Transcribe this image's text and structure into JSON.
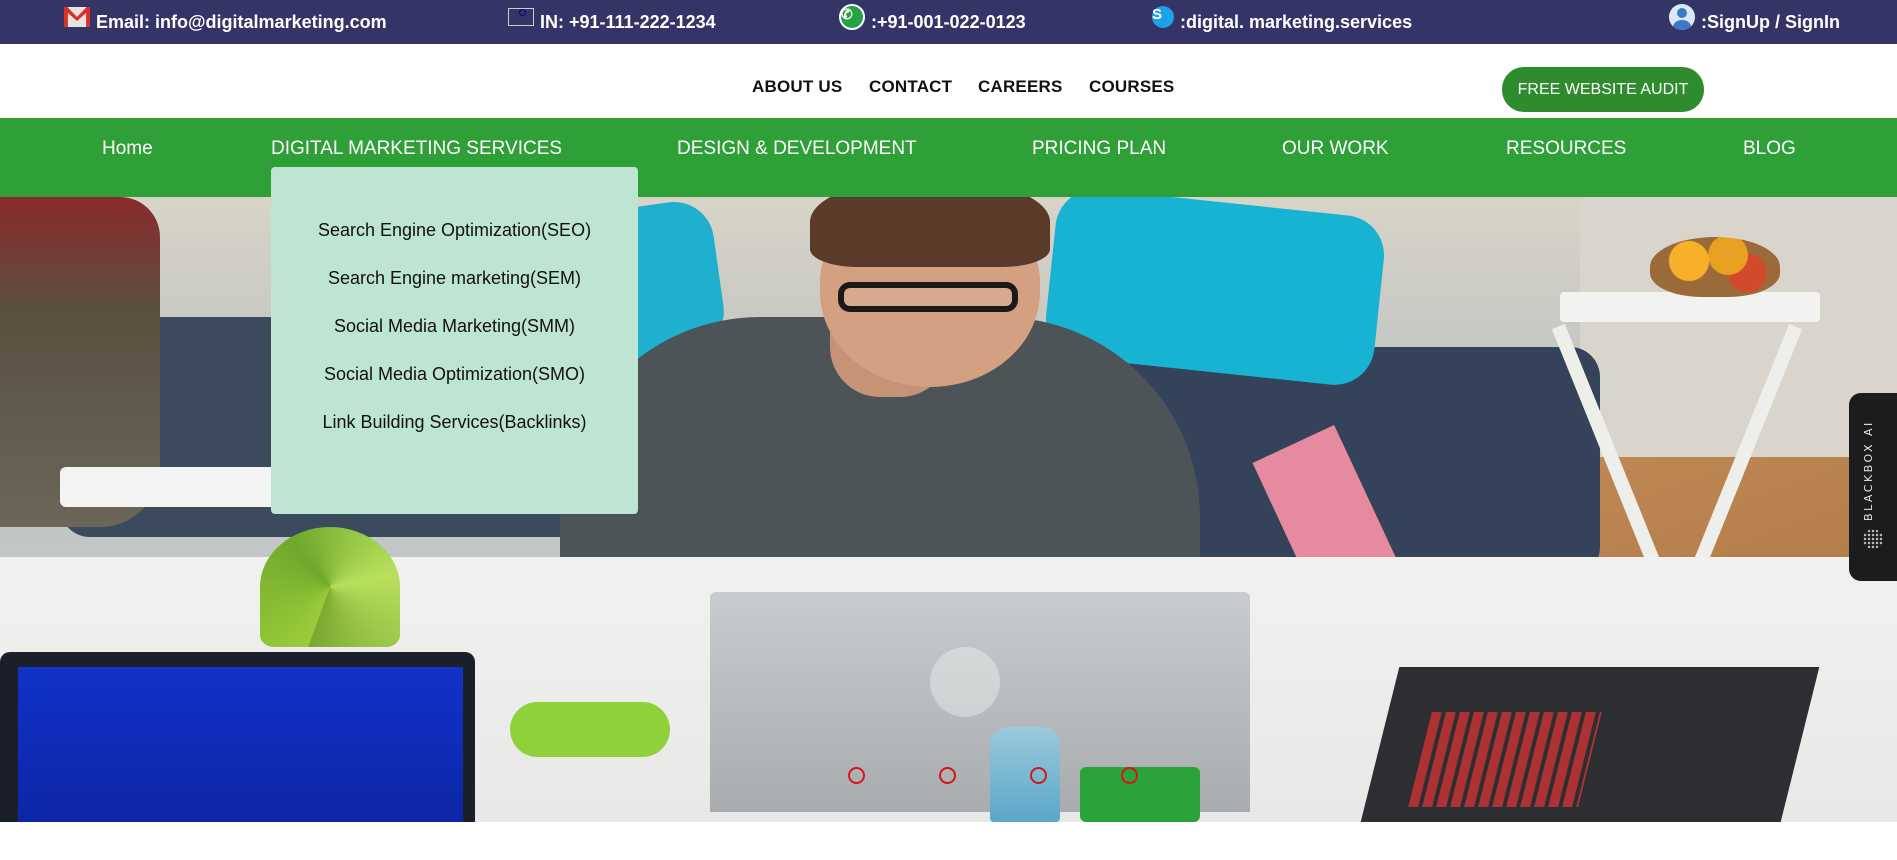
{
  "topbar": {
    "email": "Email: info@digitalmarketing.com",
    "phone_in": "IN: +91-111-222-1234",
    "whatsapp": ":+91-001-022-0123",
    "skype": ":digital. marketing.services",
    "signup": ":SignUp / SignIn",
    "icons": [
      "mail-icon",
      "india-flag-icon",
      "whatsapp-icon",
      "skype-icon",
      "user-icon"
    ]
  },
  "secondary_nav": {
    "links": [
      "ABOUT US",
      "CONTACT",
      "CAREERS",
      "COURSES"
    ],
    "cta": "FREE WEBSITE AUDIT"
  },
  "main_nav": {
    "items": [
      "Home",
      "DIGITAL MARKETING SERVICES",
      "DESIGN & DEVELOPMENT",
      "PRICING PLAN",
      "OUR WORK",
      "RESOURCES",
      "BLOG"
    ]
  },
  "dropdown": {
    "items": [
      "Search Engine Optimization(SEO)",
      "Search Engine marketing(SEM)",
      "Social Media Marketing(SMM)",
      "Social Media Optimization(SMO)",
      "Link Building Services(Backlinks)"
    ]
  },
  "carousel": {
    "slide_count": 4
  },
  "sidetab": {
    "label": "BLACKBOX AI"
  },
  "colors": {
    "topbar": "#353466",
    "main_nav": "#2fa038",
    "cta": "#2e8b2e",
    "dropdown": "#bde5d2",
    "carousel_dot": "#d81515"
  }
}
